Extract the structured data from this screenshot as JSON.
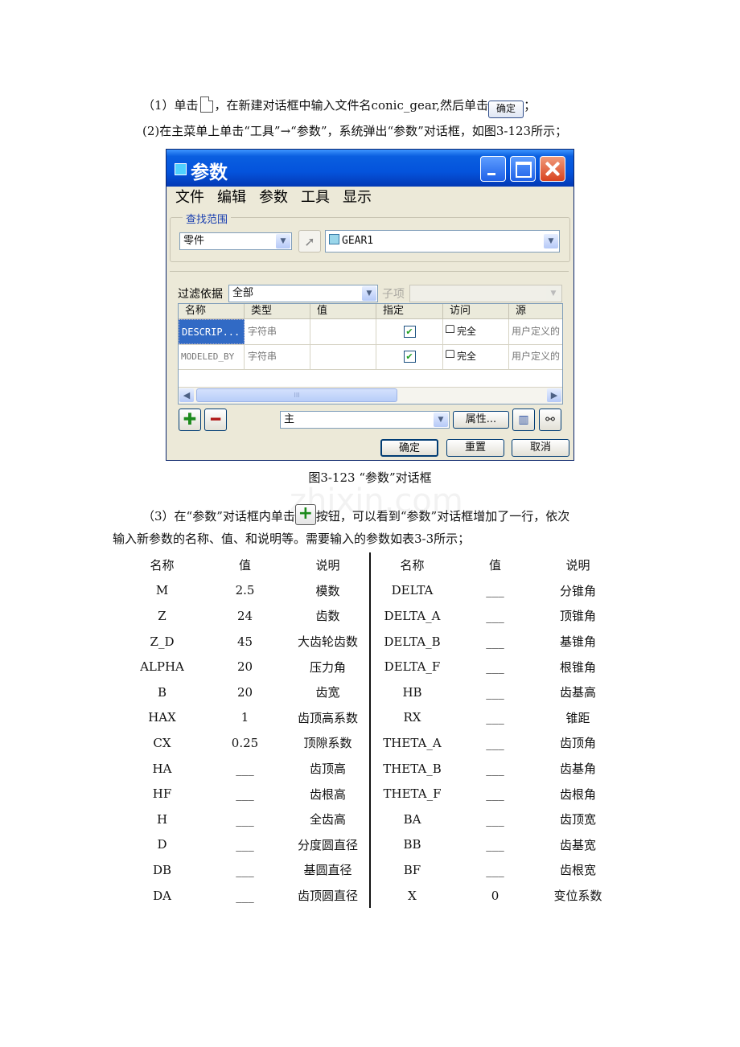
{
  "steps": {
    "step1": {
      "prefix": "（1）单击",
      "mid": "，在新建对话框中输入文件名conic_gear,然后单击",
      "ok_icon_label": "确定",
      "suffix": "；"
    },
    "step2": "(2)在主菜单上单击“工具”→“参数”，系统弹出“参数”对话框，如图3-123所示；",
    "step3": {
      "prefix": "（3）在“参数”对话框内单击",
      "suffix": "按钮，可以看到“参数”对话框增加了一行，依次",
      "line2": "输入新参数的名称、值、和说明等。需要输入的参数如表3-3所示；"
    }
  },
  "dialog": {
    "title": "参数",
    "menu": [
      "文件",
      "编辑",
      "参数",
      "工具",
      "显示"
    ],
    "scope_group_title": "查找范围",
    "scope_type": "零件",
    "scope_object": "GEAR1",
    "filter_label": "过滤依据",
    "filter_value": "全部",
    "subitem_label": "子项",
    "columns": [
      "名称",
      "类型",
      "值",
      "指定",
      "访问",
      "源"
    ],
    "rows": [
      {
        "name": "DESCRIP...",
        "type": "字符串",
        "value": "",
        "access": "完全",
        "source": "用户定义的"
      },
      {
        "name": "MODELED_BY",
        "type": "字符串",
        "value": "",
        "access": "完全",
        "source": "用户定义的"
      }
    ],
    "scroll_thumb_text": "III",
    "bottom_combo": "主",
    "properties_button": "属性...",
    "ok_button": "确定",
    "reset_button": "重置",
    "cancel_button": "取消"
  },
  "figure_caption": "图3-123 “参数”对话框",
  "watermark": "zhixin.com",
  "params_table": {
    "headers": [
      "名称",
      "值",
      "说明",
      "名称",
      "值",
      "说明"
    ],
    "rows": [
      [
        "M",
        "2.5",
        "模数",
        "DELTA",
        "___",
        "分锥角"
      ],
      [
        "Z",
        "24",
        "齿数",
        "DELTA_A",
        "___",
        "顶锥角"
      ],
      [
        "Z_D",
        "45",
        "大齿轮齿数",
        "DELTA_B",
        "___",
        "基锥角"
      ],
      [
        "ALPHA",
        "20",
        "压力角",
        "DELTA_F",
        "___",
        "根锥角"
      ],
      [
        "B",
        "20",
        "齿宽",
        "HB",
        "___",
        "齿基高"
      ],
      [
        "HAX",
        "1",
        "齿顶高系数",
        "RX",
        "___",
        "锥距"
      ],
      [
        "CX",
        "0.25",
        "顶隙系数",
        "THETA_A",
        "___",
        "齿顶角"
      ],
      [
        "HA",
        "___",
        "齿顶高",
        "THETA_B",
        "___",
        "齿基角"
      ],
      [
        "HF",
        "___",
        "齿根高",
        "THETA_F",
        "___",
        "齿根角"
      ],
      [
        "H",
        "___",
        "全齿高",
        "BA",
        "___",
        "齿顶宽"
      ],
      [
        "D",
        "___",
        "分度圆直径",
        "BB",
        "___",
        "齿基宽"
      ],
      [
        "DB",
        "___",
        "基圆直径",
        "BF",
        "___",
        "齿根宽"
      ],
      [
        "DA",
        "___",
        "齿顶圆直径",
        "X",
        "0",
        "变位系数"
      ]
    ]
  }
}
